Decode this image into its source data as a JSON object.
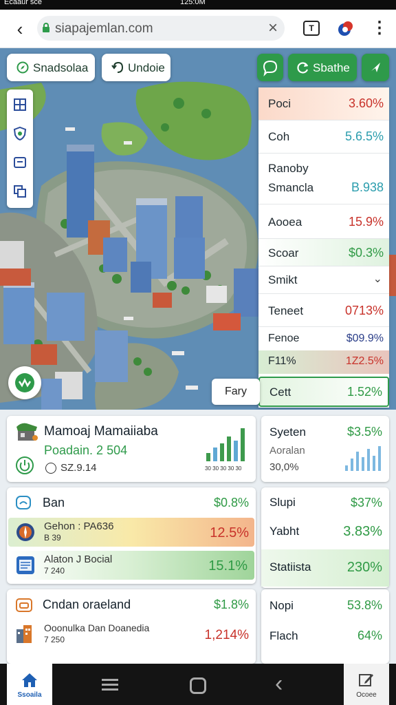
{
  "status_bar": {
    "left": "Ecaaur sce",
    "time": "125:0M"
  },
  "browser": {
    "url": "siapajemlan.com",
    "tab_count": "T"
  },
  "map_controls": {
    "chip_left": "Snadsolaa",
    "chip_right": "Undoie",
    "action_button": "Sbathe",
    "fav_chip": "Fary"
  },
  "stats_panel": {
    "rows": [
      {
        "label": "Poci",
        "value": "3.60%",
        "tone": "red"
      },
      {
        "label": "Coh",
        "value": "5.6.5%",
        "tone": "teal"
      },
      {
        "label": "Ranoby",
        "value": "",
        "tone": ""
      },
      {
        "label": "Smancla",
        "value": "B.938",
        "tone": "teal"
      },
      {
        "label": "Aooea",
        "value": "15.9%",
        "tone": "red"
      },
      {
        "label": "Scoar",
        "value": "$0.3%",
        "tone": "green"
      },
      {
        "label": "Smikt",
        "value": "",
        "tone": ""
      },
      {
        "label": "Teneet",
        "value": "0713%",
        "tone": "red"
      },
      {
        "label": "Fenoe",
        "value": "$09.9%",
        "tone": "navy"
      },
      {
        "label": "F11%",
        "value": "1Z2.5%",
        "tone": "red"
      },
      {
        "label": "Cett",
        "value": "1.52%",
        "tone": "green"
      }
    ]
  },
  "cards": {
    "main": {
      "title": "Mamoaj Mamaiiaba",
      "subtitle": "Poadain. 2 504",
      "meta": "SZ.9.14",
      "axis": "30 30 30 30 30"
    },
    "system": {
      "title": "Syeten",
      "value": "$3.5%",
      "sub": "Aoralan",
      "sub_value": "30,0%"
    },
    "list_a": {
      "title": "Ban",
      "value": "$0.8%",
      "rows": [
        {
          "label": "Gehon : PA636",
          "sub": "B 39",
          "value": "12.5%",
          "tone": "red"
        },
        {
          "label": "Alaton J Bocial",
          "sub": "7 240",
          "value": "15.1%",
          "tone": "green"
        }
      ]
    },
    "list_b": {
      "rows": [
        {
          "label": "Slupi",
          "value": "$37%"
        },
        {
          "label": "Yabht",
          "value": "3.83%"
        },
        {
          "label": "Statiista",
          "value": "230%"
        }
      ]
    },
    "list_c": {
      "title": "Cndan oraeland",
      "value": "$1.8%",
      "row_label": "Ooonulka Dan Doanedia",
      "row_sub": "7 250",
      "row_value": "1,214%"
    },
    "list_d": {
      "rows": [
        {
          "label": "Nopi",
          "value": "53.8%"
        },
        {
          "label": "Flach",
          "value": "64%"
        }
      ]
    }
  },
  "nav": {
    "home_label": "Ssoaila",
    "right_label": "Ocoee"
  },
  "colors": {
    "accent_green": "#2e9a4a",
    "red": "#c8322a",
    "teal": "#2b9dad"
  }
}
